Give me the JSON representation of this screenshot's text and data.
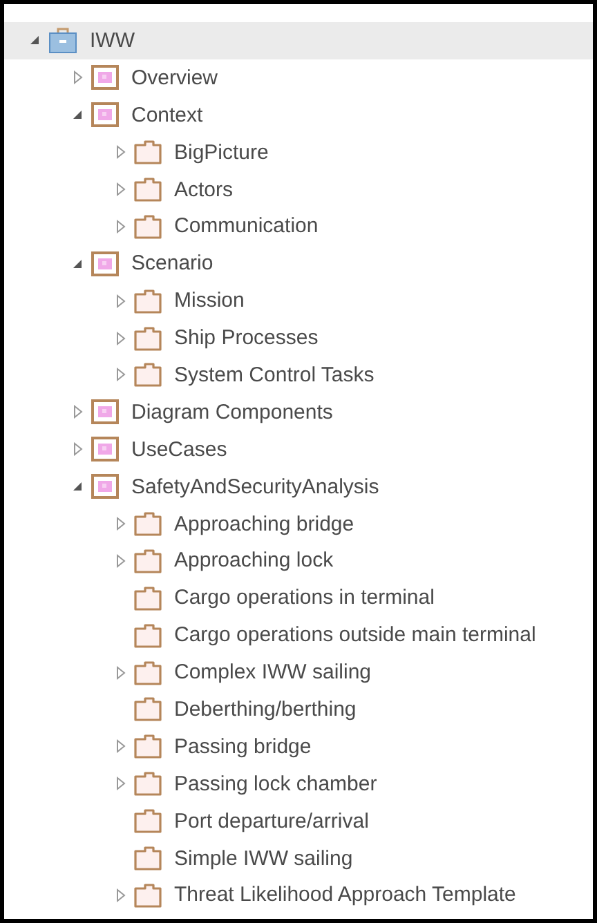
{
  "tree": [
    {
      "label": "IWW",
      "kind": "model",
      "expanded": true,
      "selected": true,
      "children": [
        {
          "label": "Overview",
          "kind": "package",
          "expanded": false,
          "selected": false
        },
        {
          "label": "Context",
          "kind": "package",
          "expanded": true,
          "selected": false,
          "children": [
            {
              "label": "BigPicture",
              "kind": "folder",
              "expanded": false,
              "selected": false
            },
            {
              "label": "Actors",
              "kind": "folder",
              "expanded": false,
              "selected": false
            },
            {
              "label": "Communication",
              "kind": "folder",
              "expanded": false,
              "selected": false
            }
          ]
        },
        {
          "label": "Scenario",
          "kind": "package",
          "expanded": true,
          "selected": false,
          "children": [
            {
              "label": "Mission",
              "kind": "folder",
              "expanded": false,
              "selected": false
            },
            {
              "label": "Ship Processes",
              "kind": "folder",
              "expanded": false,
              "selected": false
            },
            {
              "label": "System Control Tasks",
              "kind": "folder",
              "expanded": false,
              "selected": false
            }
          ]
        },
        {
          "label": "Diagram Components",
          "kind": "package",
          "expanded": false,
          "selected": false
        },
        {
          "label": "UseCases",
          "kind": "package",
          "expanded": false,
          "selected": false
        },
        {
          "label": "SafetyAndSecurityAnalysis",
          "kind": "package",
          "expanded": true,
          "selected": false,
          "children": [
            {
              "label": "Approaching bridge",
              "kind": "folder",
              "expanded": false,
              "selected": false
            },
            {
              "label": "Approaching lock",
              "kind": "folder",
              "expanded": false,
              "selected": false
            },
            {
              "label": "Cargo operations in terminal",
              "kind": "folder",
              "selected": false
            },
            {
              "label": "Cargo operations outside main terminal",
              "kind": "folder",
              "selected": false
            },
            {
              "label": "Complex IWW sailing",
              "kind": "folder",
              "expanded": false,
              "selected": false
            },
            {
              "label": "Deberthing/berthing",
              "kind": "folder",
              "selected": false
            },
            {
              "label": "Passing bridge",
              "kind": "folder",
              "expanded": false,
              "selected": false
            },
            {
              "label": "Passing lock chamber",
              "kind": "folder",
              "expanded": false,
              "selected": false
            },
            {
              "label": "Port departure/arrival",
              "kind": "folder",
              "selected": false
            },
            {
              "label": "Simple IWW sailing",
              "kind": "folder",
              "selected": false
            },
            {
              "label": "Threat Likelihood Approach Template",
              "kind": "folder",
              "expanded": false,
              "selected": false
            }
          ]
        }
      ]
    }
  ]
}
